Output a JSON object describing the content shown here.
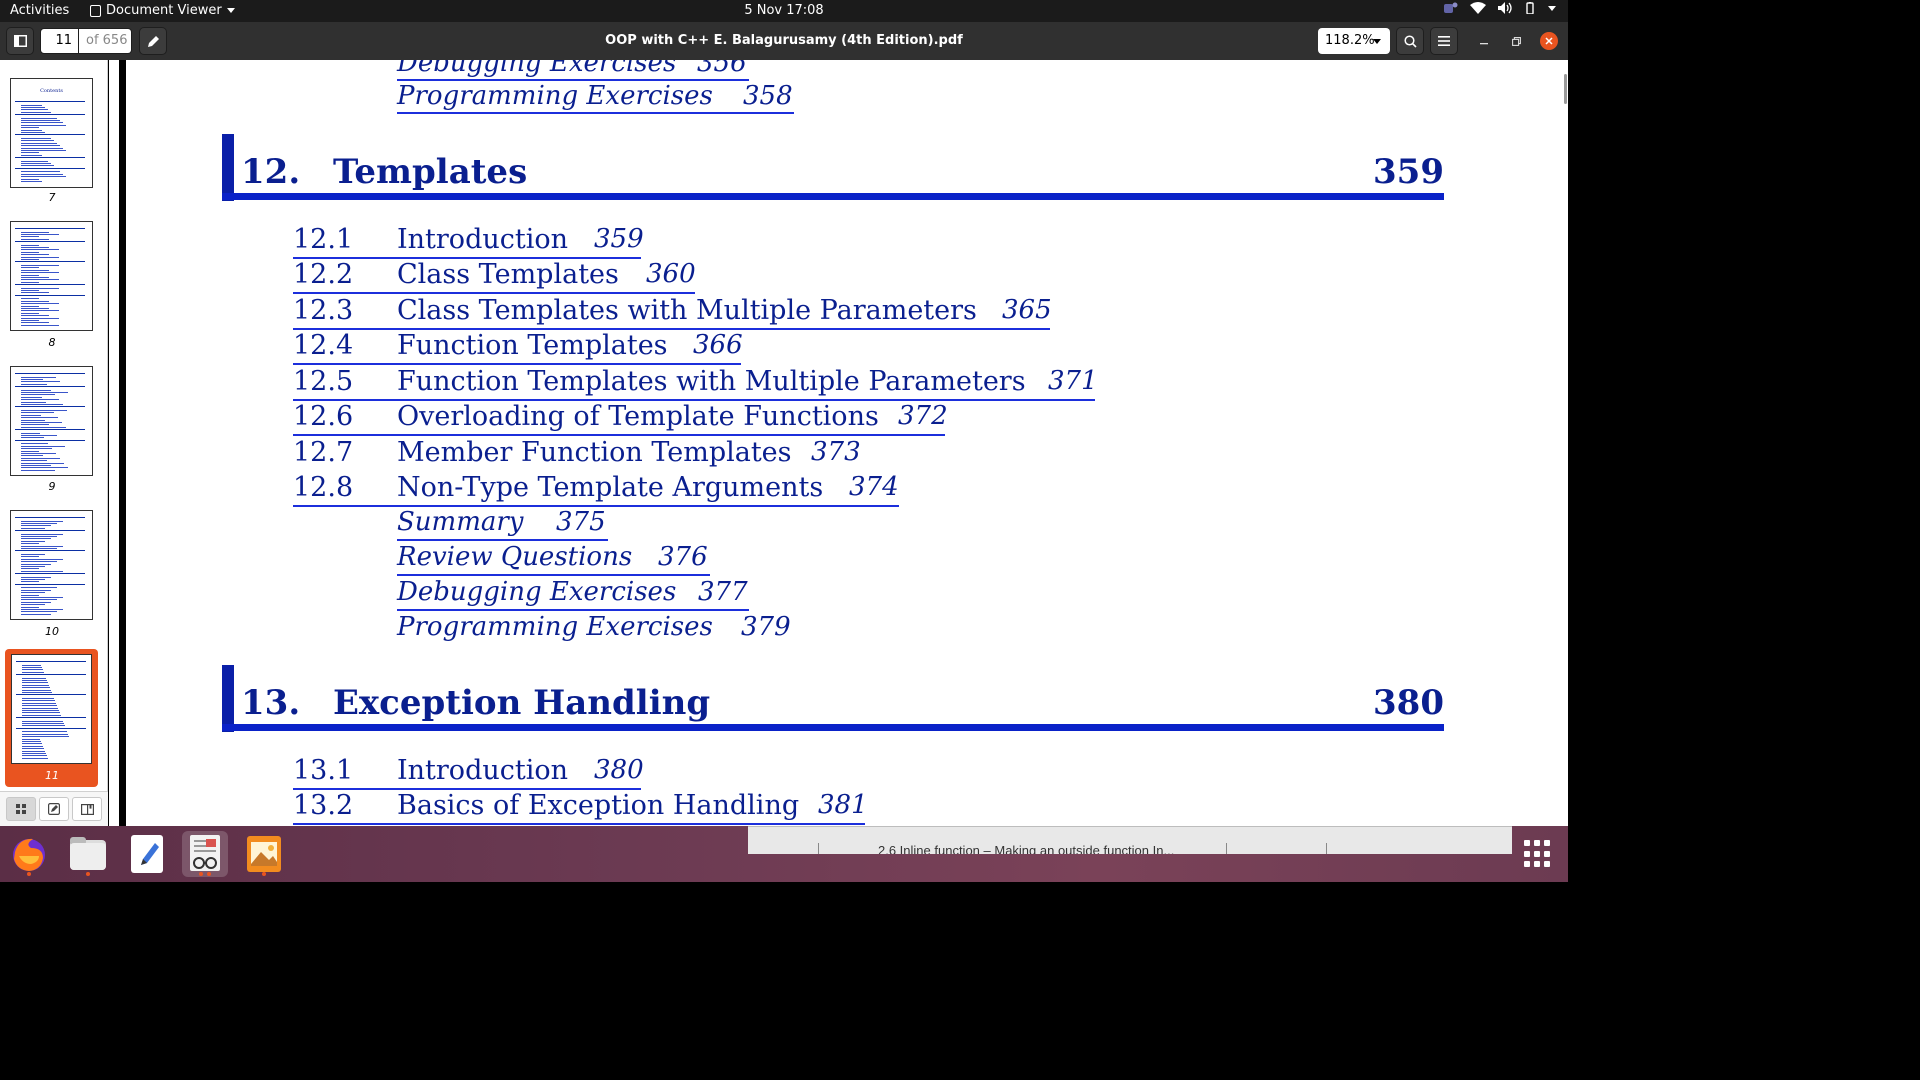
{
  "topbar": {
    "activities": "Activities",
    "app_name": "Document Viewer",
    "clock": "5 Nov  17:08"
  },
  "header": {
    "page_current": "11",
    "page_total": "of 656",
    "title": "OOP with C++ E. Balagurusamy (4th Edition).pdf",
    "zoom": "118.2%"
  },
  "sidebar": {
    "thumbnails": [
      {
        "label": "7",
        "selected": false
      },
      {
        "label": "8",
        "selected": false
      },
      {
        "label": "9",
        "selected": false
      },
      {
        "label": "10",
        "selected": false
      },
      {
        "label": "11",
        "selected": true
      }
    ],
    "thumb1_heading": "Contents"
  },
  "document": {
    "prev_tail": [
      {
        "title": "Debugging Exercises",
        "page": "356"
      },
      {
        "title": "Programming Exercises",
        "page": "358"
      }
    ],
    "chapter12": {
      "num": "12.",
      "title": "Templates",
      "page": "359",
      "sections": [
        {
          "num": "12.1",
          "title": "Introduction",
          "page": "359"
        },
        {
          "num": "12.2",
          "title": "Class Templates",
          "page": "360"
        },
        {
          "num": "12.3",
          "title": "Class Templates with Multiple Parameters",
          "page": "365"
        },
        {
          "num": "12.4",
          "title": "Function Templates",
          "page": "366"
        },
        {
          "num": "12.5",
          "title": "Function Templates with Multiple Parameters",
          "page": "371"
        },
        {
          "num": "12.6",
          "title": "Overloading of Template Functions",
          "page": "372"
        },
        {
          "num": "12.7",
          "title": "Member Function Templates",
          "page": "373"
        },
        {
          "num": "12.8",
          "title": "Non-Type Template Arguments",
          "page": "374"
        }
      ],
      "extras": [
        {
          "title": "Summary",
          "page": "375"
        },
        {
          "title": "Review Questions",
          "page": "376"
        },
        {
          "title": "Debugging Exercises",
          "page": "377"
        },
        {
          "title": "Programming Exercises",
          "page": "379"
        }
      ]
    },
    "chapter13": {
      "num": "13.",
      "title": "Exception Handling",
      "page": "380",
      "sections": [
        {
          "num": "13.1",
          "title": "Introduction",
          "page": "380"
        },
        {
          "num": "13.2",
          "title": "Basics of Exception Handling",
          "page": "381"
        }
      ]
    }
  },
  "background_window": {
    "text": "2.6 Inline function – Making an outside function In..."
  },
  "dock": {
    "apps": [
      "firefox-icon",
      "files-icon",
      "text-editor-icon",
      "document-viewer-icon",
      "image-viewer-icon"
    ]
  },
  "colors": {
    "accent": "#e95420",
    "link_blue": "#1c2fdc",
    "heading_blue": "#0a1f8f"
  }
}
